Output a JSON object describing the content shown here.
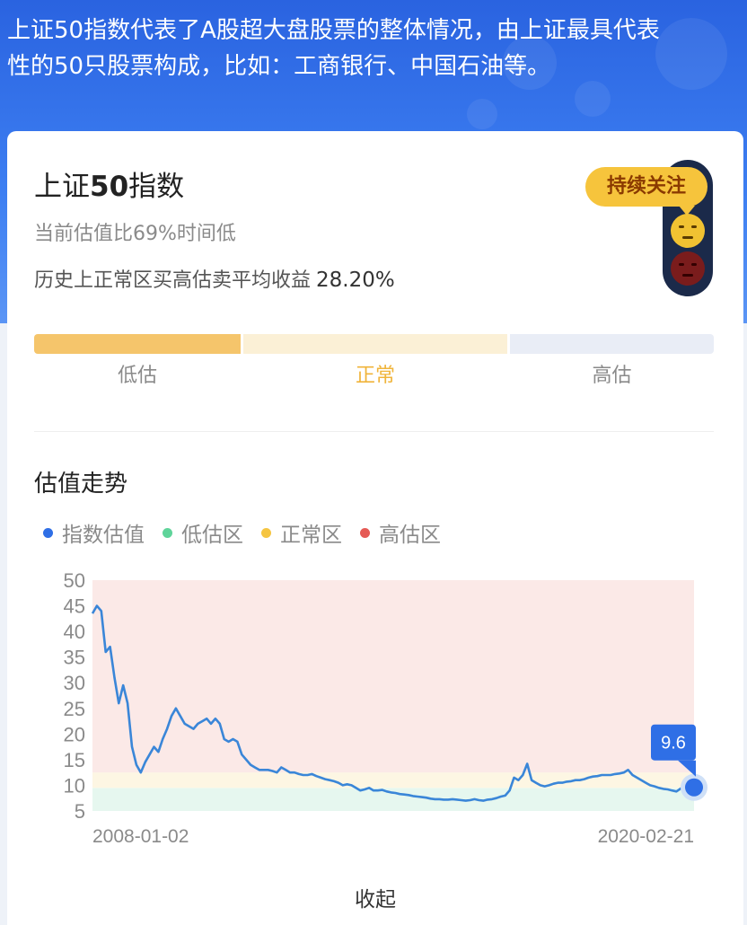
{
  "banner": {
    "text_line1": "上证50指数代表了A股超大盘股票的整体情况，由上证最具代表",
    "text_line2": "性的50只股票构成，比如：工商银行、中国石油等。"
  },
  "card": {
    "title_prefix": "上证",
    "title_bold": "50",
    "title_suffix": "指数",
    "valuation_text": "当前估值比69%时间低",
    "return_label": "历史上正常区买高估卖平均收益",
    "return_value": "28.20%",
    "tag": "持续关注",
    "segments": {
      "low": "低估",
      "normal": "正常",
      "high": "高估"
    },
    "trend_title": "估值走势",
    "legend": [
      {
        "label": "指数估值",
        "color": "#2f6fe6"
      },
      {
        "label": "低估区",
        "color": "#5fd49a"
      },
      {
        "label": "正常区",
        "color": "#f5c542"
      },
      {
        "label": "高估区",
        "color": "#e55a55"
      }
    ],
    "collapse": "收起"
  },
  "chart_data": {
    "type": "line",
    "x_start": "2008-01-02",
    "x_end": "2020-02-21",
    "ylim": [
      5,
      50
    ],
    "yticks": [
      5,
      10,
      15,
      20,
      25,
      30,
      35,
      40,
      45,
      50
    ],
    "zones": [
      {
        "name": "低估区",
        "from": 5,
        "to": 9.5,
        "color": "#e6f7ef"
      },
      {
        "name": "正常区",
        "from": 9.5,
        "to": 12.5,
        "color": "#fdf6e3"
      },
      {
        "name": "高估区",
        "from": 12.5,
        "to": 50,
        "color": "#fbe9e7"
      }
    ],
    "last_value_label": "9.6",
    "series": [
      {
        "values": [
          43.5,
          45,
          44,
          36,
          37,
          31,
          26,
          29.5,
          26,
          17.5,
          14,
          12.5,
          14.5,
          16,
          17.5,
          16.5,
          19,
          21,
          23.5,
          25,
          23.5,
          22,
          21.5,
          21,
          22,
          22.5,
          23,
          22,
          23,
          22,
          19,
          18.5,
          19,
          18.5,
          16,
          15,
          14,
          13.5,
          13,
          13,
          13,
          12.8,
          12.5,
          13.5,
          13,
          12.5,
          12.5,
          12.2,
          12,
          12,
          12.2,
          11.8,
          11.5,
          11.2,
          11,
          10.8,
          10.5,
          10,
          10.2,
          10,
          9.5,
          9,
          9.2,
          9.5,
          9,
          9,
          9.1,
          8.8,
          8.6,
          8.5,
          8.3,
          8.2,
          8.1,
          7.9,
          7.8,
          7.7,
          7.6,
          7.4,
          7.3,
          7.3,
          7.2,
          7.2,
          7.3,
          7.2,
          7.1,
          7,
          7.1,
          7.3,
          7.1,
          7,
          7.2,
          7.3,
          7.5,
          7.8,
          8,
          9,
          11.5,
          11,
          12,
          14.2,
          11,
          10.5,
          10,
          9.8,
          10,
          10.3,
          10.5,
          10.5,
          10.7,
          10.8,
          11,
          11,
          11.2,
          11.5,
          11.7,
          11.8,
          12,
          12,
          12,
          12.2,
          12.3,
          12.5,
          13,
          12,
          11.5,
          11,
          10.5,
          10,
          9.8,
          9.5,
          9.3,
          9.2,
          9,
          8.8,
          9.4,
          9.8,
          10,
          9.6
        ]
      }
    ]
  }
}
